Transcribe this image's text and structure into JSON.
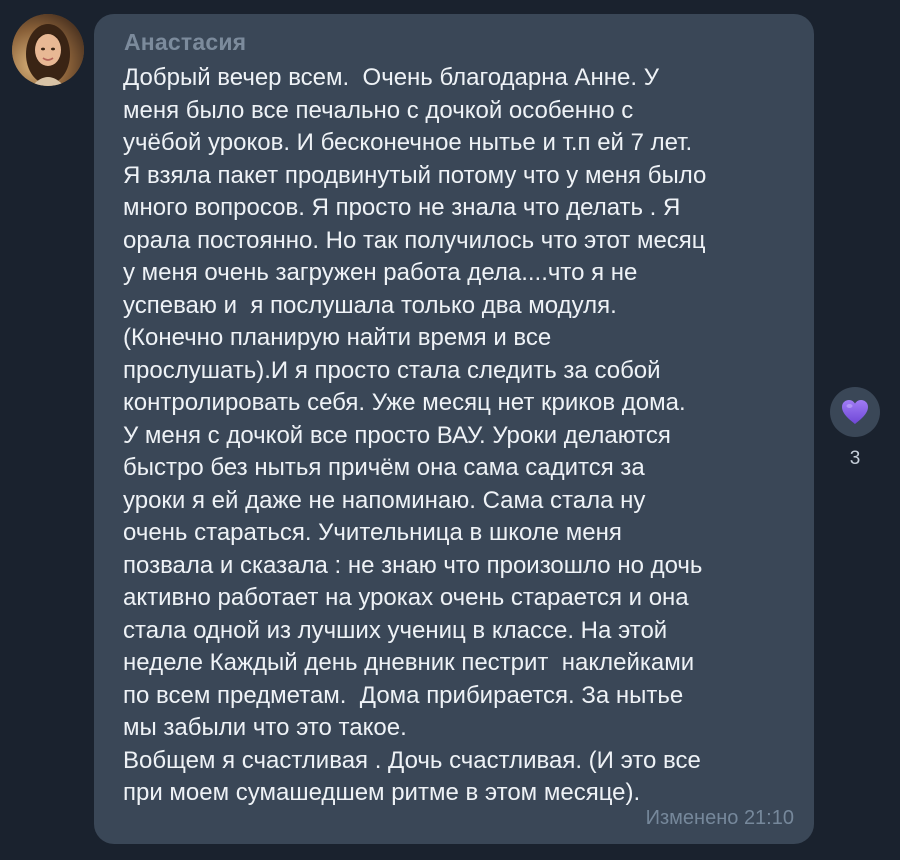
{
  "message": {
    "author": "Анастасия",
    "lines": [
      "Добрый вечер всем.  Очень благодарна Анне. У",
      "меня было все печально с дочкой особенно с",
      "учёбой уроков. И бесконечное нытье и т.п ей 7 лет.",
      "Я взяла пакет продвинутый потому что у меня было",
      "много вопросов. Я просто не знала что делать . Я",
      "орала постоянно. Но так получилось что этот месяц",
      "у меня очень загружен работа дела....что я не",
      "успеваю и  я послушала только два модуля.",
      "(Конечно планирую найти время и все",
      "прослушать).И я просто стала следить за собой",
      "контролировать себя. Уже месяц нет криков дома.",
      "У меня с дочкой все просто ВАУ. Уроки делаются",
      "быстро без нытья причём она сама садится за",
      "уроки я ей даже не напоминаю. Сама стала ну",
      "очень стараться. Учительница в школе меня",
      "позвала и сказала : не знаю что произошло но дочь",
      "активно работает на уроках очень старается и она",
      "стала одной из лучших учениц в классе. На этой",
      "неделе Каждый день дневник пестрит  наклейками",
      "по всем предметам.  Дома прибирается. За нытье",
      "мы забыли что это такое.",
      "Вобщем я счастливая . Дочь счастливая. (И это все",
      "при моем сумашедшем ритме в этом месяце)."
    ],
    "status": "Изменено",
    "time": "21:10"
  },
  "reaction": {
    "icon": "purple-heart-icon",
    "count": "3"
  },
  "colors": {
    "background": "#1a222e",
    "bubble": "#3a4757",
    "author": "#7c8b9c",
    "text": "#eef2f6",
    "meta": "#76889b",
    "heart": "#8a63e8"
  }
}
